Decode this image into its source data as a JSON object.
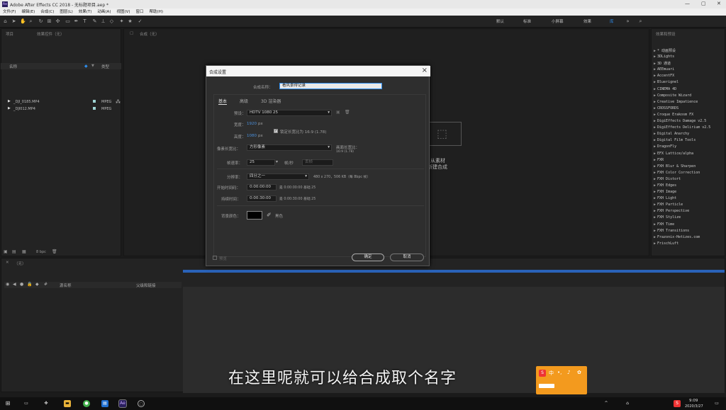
{
  "window": {
    "title": "Adobe After Effects CC 2018 - 无标题项目.aep *",
    "app_icon": "Ae",
    "controls": [
      "—",
      "▢",
      "✕"
    ]
  },
  "menu": [
    "文件(F)",
    "编辑(E)",
    "合成(C)",
    "图层(L)",
    "效果(T)",
    "动画(A)",
    "视图(V)",
    "窗口",
    "帮助(H)"
  ],
  "workspaces": [
    "默认",
    "标准",
    "小屏幕",
    "效果",
    "库"
  ],
  "project_panel": {
    "tabs": [
      "项目",
      "效果控件（无）"
    ],
    "columns": {
      "name": "名称",
      "type": "类型"
    },
    "files": [
      {
        "name": "_DJI_0185.MP4",
        "type": "MPEG"
      },
      {
        "name": "_DJI012.MP4",
        "type": "MPEG"
      }
    ],
    "bpc": "8 bpc"
  },
  "comp_panel": {
    "tab": "合成（无）",
    "new_comp_line1": "从素材",
    "new_comp_line2": "新建合成"
  },
  "effects_panel": {
    "tab": "效果和预设",
    "items": [
      "* 动画预设",
      "3DLights",
      "3D 通道",
      "AEEmuari",
      "AccentFX",
      "Bluerignel",
      "CINEMA 4D",
      "Composite Wizard",
      "Creative Impatience",
      "CROSSFORDS",
      "Croque Erakosm FX",
      "DigiEffects Damage v2.5",
      "DigiEffects Delirium v2.5",
      "Digital Anarchy",
      "Digital Film Tools",
      "DragonFly",
      "EFX Lattice/alpha",
      "FXR",
      "FXH Blur & Sharpen",
      "FXH Color Correction",
      "FXH Distort",
      "FXH Edges",
      "FXH Image",
      "FXH Light",
      "FXH Particle",
      "FXH Perspective",
      "FXH Stylize",
      "FXH Time",
      "FXH Transitions",
      "Frazonix-Hetizes.com",
      "FrischLuft"
    ]
  },
  "timeline": {
    "tab": "（无）",
    "columns": {
      "layer_name": "源名称",
      "parent": "父级和链接"
    }
  },
  "dialog": {
    "title": "合成设置",
    "name_label": "合成名称：",
    "name_value": "看风景得记录",
    "tabs": [
      "基本",
      "高级",
      "3D 渲染器"
    ],
    "preset_label": "预设：",
    "preset_value": "HDTV 1080 25",
    "width_label": "宽度：",
    "width_value": "1920",
    "width_unit": "px",
    "lock_label": "锁定长宽比为 16:9 (1.78)",
    "height_label": "高度：",
    "height_value": "1080",
    "height_unit": "px",
    "par_label": "像素长宽比：",
    "par_value": "方形像素",
    "frame_aspect_label": "画面长宽比：",
    "frame_aspect_value": "16:9 (1.78)",
    "fps_label": "帧速率：",
    "fps_value": "25",
    "fps_unit": "帧/秒",
    "drop_frame": "丢帧",
    "resolution_label": "分辨率：",
    "resolution_value": "四分之一",
    "resolution_info": "480 x 270，506 KB（每 8bpc 帧）",
    "start_tc_label": "开始时间码：",
    "start_tc_value": "0:00:00:00",
    "start_tc_info": "是 0:00:00:00 基础 25",
    "duration_label": "持续时间：",
    "duration_value": "0:00:30:00",
    "duration_info": "是 0:00:30:00 基础 25",
    "bg_label": "背景颜色：",
    "bg_name": "黑色",
    "bg_color": "#000000",
    "preview_label": "预览",
    "ok": "确定",
    "cancel": "取消"
  },
  "subtitle": "在这里呢就可以给合成取个名字",
  "taskbar": {
    "time": "9:09",
    "date": "2020/3/27",
    "ime_label": "中"
  },
  "colors": {
    "accent": "#2d8ceb",
    "ime": "#f39a1e"
  }
}
